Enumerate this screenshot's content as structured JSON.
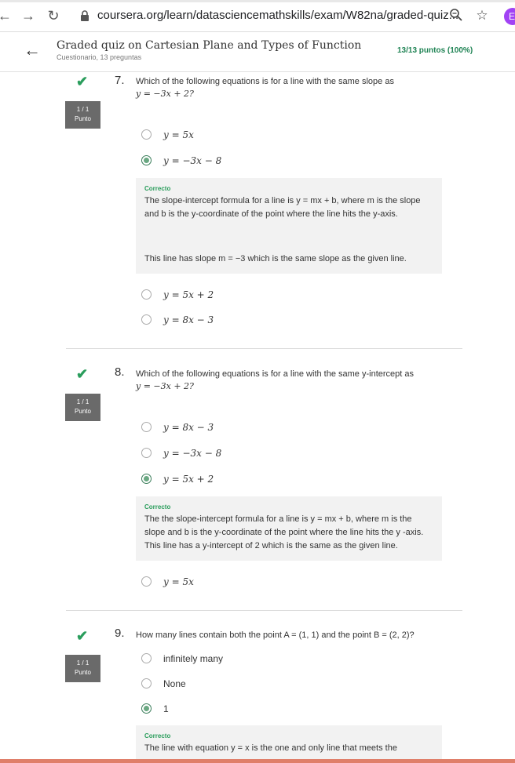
{
  "browser": {
    "url": "coursera.org/learn/datasciencemathskills/exam/W82na/graded-quiz...",
    "profile_initial": "E"
  },
  "header": {
    "title": "Graded quiz on Cartesian Plane and Types of Function",
    "subtitle": "Cuestionario, 13 preguntas",
    "score": "13/13 puntos (100%)"
  },
  "questions": [
    {
      "number": "7.",
      "text_line1": "Which of the following equations is for a line with the same slope as",
      "text_line2": "y = −3x + 2?",
      "badge_line1": "1 / 1",
      "badge_line2": "Punto",
      "options": [
        "y = 5x",
        "y = −3x − 8",
        "y = 5x + 2",
        "y = 8x − 3"
      ],
      "selected": 1,
      "feedback_label": "Correcto",
      "feedback_p1": "The slope-intercept formula for a line is y = mx + b, where m is the slope and b is the y-coordinate of the point where the line hits the y-axis.",
      "feedback_p2": "This line has slope m = −3 which is the same slope as the given line."
    },
    {
      "number": "8.",
      "text_line1": "Which of the following equations is for a line with the same y-intercept as",
      "text_line2": "y = −3x + 2?",
      "badge_line1": "1 / 1",
      "badge_line2": "Punto",
      "options": [
        "y = 8x − 3",
        "y = −3x − 8",
        "y = 5x + 2",
        "y = 5x"
      ],
      "selected": 2,
      "feedback_label": "Correcto",
      "feedback_p1": "The the slope-intercept formula for a line is y = mx + b, where m is the slope and b is the y-coordinate of the point where the line hits the y -axis. This line has a y-intercept of 2 which is the same as the given line."
    },
    {
      "number": "9.",
      "text_line1": "How many lines contain both the point A = (1, 1) and the point B = (2, 2)?",
      "badge_line1": "1 / 1",
      "badge_line2": "Punto",
      "options": [
        "infinitely many",
        "None",
        "1"
      ],
      "selected": 2,
      "feedback_label": "Correcto",
      "feedback_p1": "The line with equation y = x is the one and only line that meets the"
    }
  ],
  "colors": {
    "correct_green": "#2a9d5c",
    "badge_gray": "#6a6a6a",
    "feedback_bg": "#f2f2f2"
  }
}
